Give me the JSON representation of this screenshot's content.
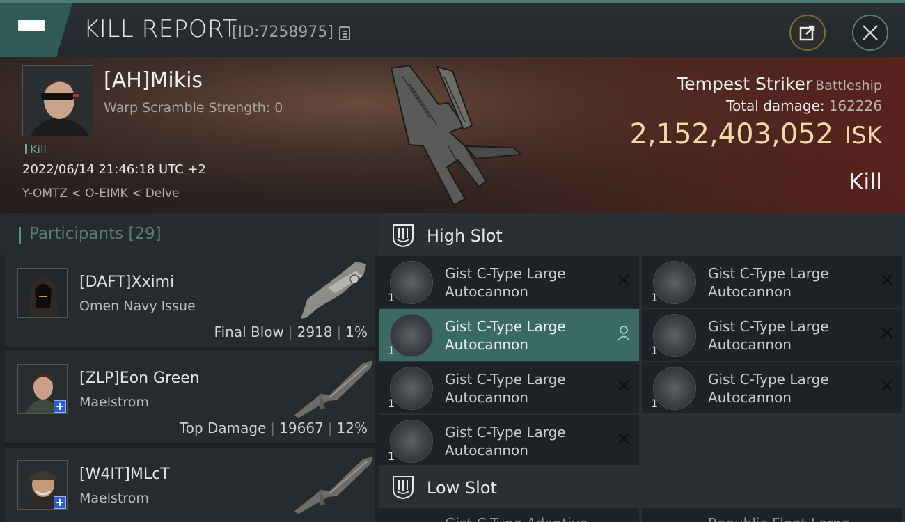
{
  "header": {
    "title": "KILL REPORT",
    "report_id": "[ID:7258975]"
  },
  "victim": {
    "name": "[AH]Mikis",
    "warp_scramble": "Warp Scramble Strength: 0",
    "tag": "Kill",
    "datetime": "2022/06/14 21:46:18 UTC +2",
    "location": "Y-OMTZ < O-EIMK < Delve",
    "ship": "Tempest Striker",
    "ship_class": "Battleship",
    "total_damage_label": "Total damage:",
    "total_damage": "162226",
    "isk_value": "2,152,403,052",
    "isk_unit": "ISK",
    "result": "Kill"
  },
  "participants": {
    "title": "Participants",
    "count": "[29]",
    "rows": [
      {
        "name": "[DAFT]Xximi",
        "ship": "Omen Navy Issue",
        "label": "Final Blow",
        "damage": "2918",
        "percent": "1%"
      },
      {
        "name": "[ZLP]Eon Green",
        "ship": "Maelstrom",
        "label": "Top Damage",
        "damage": "19667",
        "percent": "12%"
      },
      {
        "name": "[W4IT]MLcT",
        "ship": "Maelstrom"
      }
    ]
  },
  "slots": {
    "high_slot_title": "High Slot",
    "low_slot_title": "Low Slot",
    "high_modules": [
      {
        "name_line1": "Gist C-Type Large",
        "name_line2": "Autocannon",
        "qty": "1"
      },
      {
        "name_line1": "Gist C-Type Large",
        "name_line2": "Autocannon",
        "qty": "1"
      },
      {
        "name_line1": "Gist C-Type Large",
        "name_line2": "Autocannon",
        "qty": "1"
      },
      {
        "name_line1": "Gist C-Type Large",
        "name_line2": "Autocannon",
        "qty": "1"
      },
      {
        "name_line1": "Gist C-Type Large",
        "name_line2": "Autocannon",
        "qty": "1"
      },
      {
        "name_line1": "Gist C-Type Large",
        "name_line2": "Autocannon",
        "qty": "1"
      },
      {
        "name_line1": "Gist C-Type Large",
        "name_line2": "Autocannon",
        "qty": "1"
      }
    ],
    "low_modules_partial": [
      {
        "name": "Gist C-Type Adaptive"
      },
      {
        "name": "Republic Fleet Large"
      }
    ]
  },
  "colors": {
    "accent_teal": "#3b6964",
    "isk_gold": "#f2d9a8",
    "kill_tag_green": "#6ba392"
  }
}
